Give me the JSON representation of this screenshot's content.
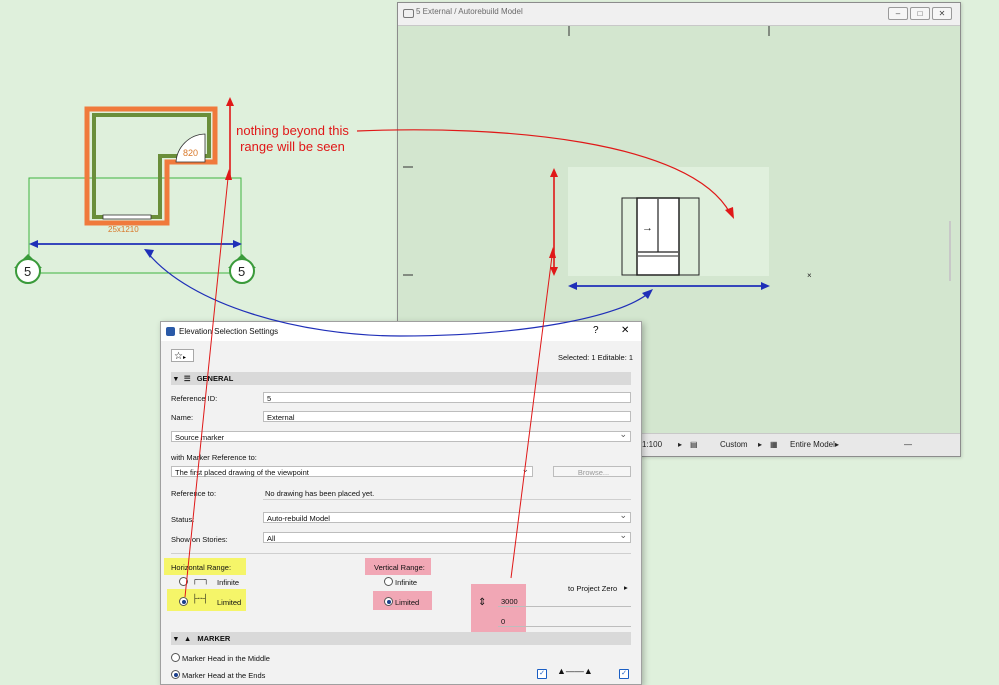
{
  "plan": {
    "dimension_label": "820",
    "dimension_sub": "25x1210",
    "marker_number": "5"
  },
  "annotation": {
    "text_line1": "nothing beyond this",
    "text_line2": "range will be seen"
  },
  "view_window": {
    "title": "5 External / Autorebuild Model",
    "status": {
      "scale": "1:100",
      "custom_label": "Custom",
      "model_label": "Entire Model"
    }
  },
  "dialog": {
    "title": "Elevation Selection Settings",
    "help": "?",
    "close": "✕",
    "selected_info": "Selected: 1 Editable: 1",
    "general": {
      "header": "GENERAL",
      "reference_id_label": "Reference ID:",
      "reference_id_value": "5",
      "name_label": "Name:",
      "name_value": "External",
      "source_marker": "Source marker",
      "marker_ref_label": "with Marker Reference to:",
      "marker_ref_value": "The first placed drawing of the viewpoint",
      "browse_label": "Browse...",
      "reference_to_label": "Reference to:",
      "reference_to_value": "No drawing has been placed yet.",
      "status_label": "Status:",
      "status_value": "Auto-rebuild Model",
      "stories_label": "Show on Stories:",
      "stories_value": "All"
    },
    "horizontal_range": {
      "label": "Horizontal Range:",
      "infinite": "Infinite",
      "limited": "Limited"
    },
    "vertical_range": {
      "label": "Vertical Range:",
      "infinite": "Infinite",
      "limited": "Limited",
      "to_project_zero": "to Project Zero",
      "top_value": "3000",
      "bottom_value": "0"
    },
    "marker": {
      "header": "MARKER",
      "head_middle": "Marker Head in the Middle",
      "head_ends": "Marker Head at the Ends"
    }
  },
  "colors": {
    "background": "#dff0dc",
    "annotation_red": "#e01818",
    "arrow_blue": "#1f2fb8",
    "highlight_yellow": "#f5f569",
    "highlight_pink": "#f1a7b5"
  }
}
